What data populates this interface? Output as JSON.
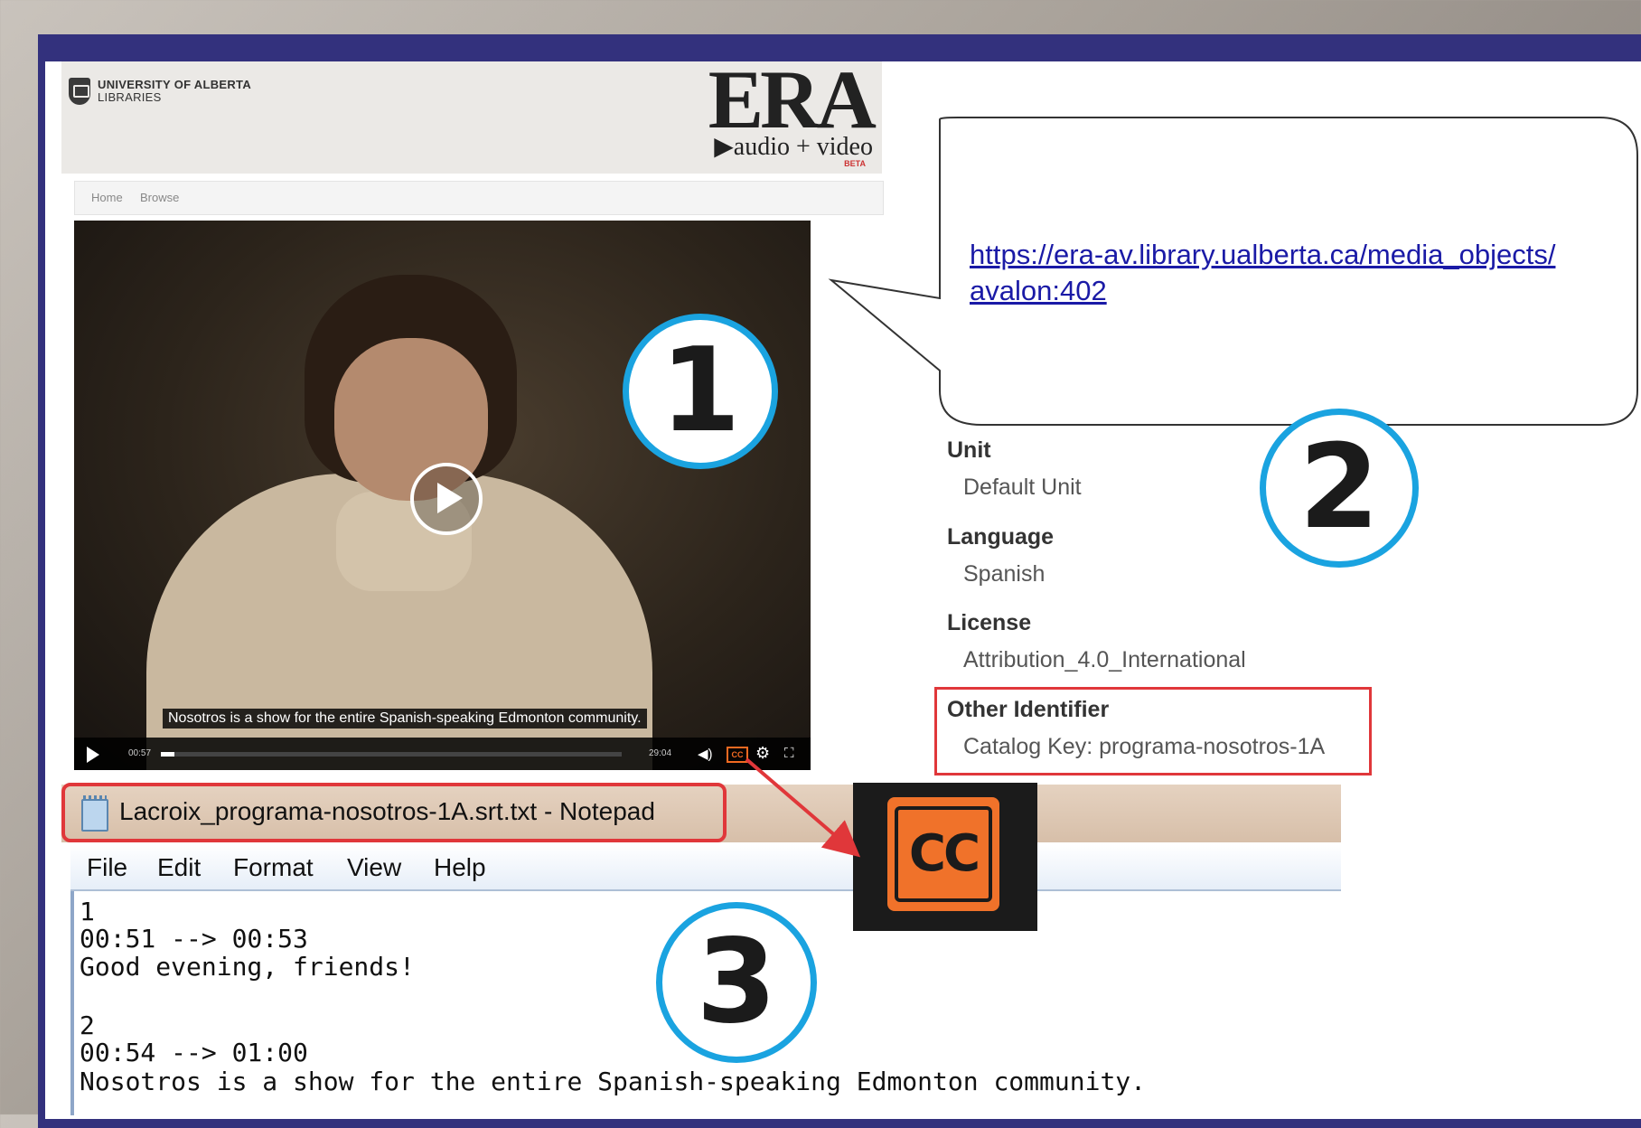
{
  "header": {
    "university_line1": "UNIVERSITY OF ALBERTA",
    "university_line2": "LIBRARIES",
    "era_logo": "ERA",
    "era_sub": "▶audio + video",
    "era_beta": "BETA"
  },
  "nav": {
    "items": [
      "Home",
      "Browse"
    ]
  },
  "video": {
    "subtitle": "Nosotros is a show for the entire Spanish-speaking Edmonton community.",
    "current_time": "00:57",
    "duration": "29:04",
    "progress_fraction": 0.03
  },
  "callout": {
    "url_line1": "https://era-av.library.ualberta.ca/media_objects/",
    "url_line2": "avalon:402"
  },
  "circles": {
    "one": "1",
    "two": "2",
    "three": "3"
  },
  "metadata": [
    {
      "label": "Unit",
      "value": "Default Unit"
    },
    {
      "label": "Language",
      "value": "Spanish"
    },
    {
      "label": "License",
      "value": "Attribution_4.0_International"
    },
    {
      "label": "Other Identifier",
      "value": "Catalog Key: programa-nosotros-1A"
    }
  ],
  "notepad": {
    "title": "Lacroix_programa-nosotros-1A.srt.txt - Notepad",
    "menu": [
      "File",
      "Edit",
      "Format",
      "View",
      "Help"
    ],
    "lines": [
      "1",
      "00:51 --> 00:53",
      "Good evening, friends!",
      "",
      "2",
      "00:54 --> 01:00",
      "Nosotros is a show for the entire Spanish-speaking Edmonton community."
    ]
  },
  "cc_label": "CC",
  "colors": {
    "frame": "#33317d",
    "circle": "#1aa3e0",
    "highlight": "#e0373a",
    "cc_orange": "#f0722a",
    "link": "#1a1aa6"
  },
  "icons": [
    "play-icon",
    "volume-icon",
    "closed-captions-icon",
    "settings-icon",
    "fullscreen-icon",
    "notepad-icon"
  ]
}
